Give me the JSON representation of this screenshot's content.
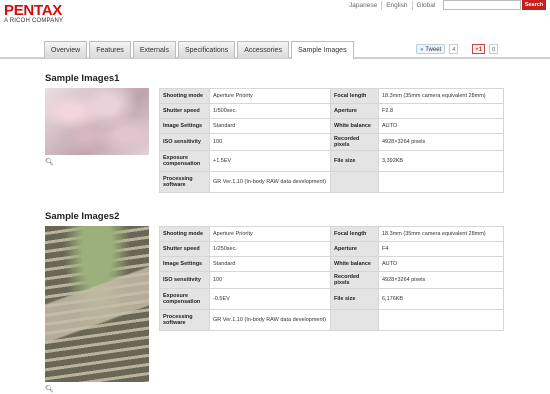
{
  "brand": {
    "name": "PENTAX",
    "tagline": "A RICOH COMPANY",
    "color": "#d20f0f"
  },
  "header": {
    "links": [
      "Japanese",
      "English",
      "Global"
    ],
    "search_placeholder": "",
    "search_button": "Search"
  },
  "tabs": [
    "Overview",
    "Features",
    "Externals",
    "Specifications",
    "Accessories",
    "Sample Images"
  ],
  "active_tab": "Sample Images",
  "social": {
    "tweet_label": "Tweet",
    "tweet_count": "4",
    "gplus_label": "+1",
    "gplus_count": "0"
  },
  "samples": [
    {
      "title": "Sample Images1",
      "rows": [
        {
          "l1": "Shooting mode",
          "v1": "Aperture Priority",
          "l2": "Focal length",
          "v2": "18.3mm (35mm camera equivalent 28mm)"
        },
        {
          "l1": "Shutter speed",
          "v1": "1/500sec.",
          "l2": "Aperture",
          "v2": "F2.8"
        },
        {
          "l1": "Image Settings",
          "v1": "Standard",
          "l2": "White balance",
          "v2": "AUTO"
        },
        {
          "l1": "ISO sensitivity",
          "v1": "100",
          "l2": "Recorded pixels",
          "v2": "4928×3264 pixels"
        },
        {
          "l1": "Exposure compensation",
          "v1": "+1.5EV",
          "l2": "File size",
          "v2": "3,392KB"
        },
        {
          "l1": "Processing software",
          "v1": "GR Ver.1.10 (In-body RAW data development)",
          "l2": "",
          "v2": ""
        }
      ]
    },
    {
      "title": "Sample Images2",
      "rows": [
        {
          "l1": "Shooting mode",
          "v1": "Aperture Priority",
          "l2": "Focal length",
          "v2": "18.3mm (35mm camera equivalent 28mm)"
        },
        {
          "l1": "Shutter speed",
          "v1": "1/250sec.",
          "l2": "Aperture",
          "v2": "F4"
        },
        {
          "l1": "Image Settings",
          "v1": "Standard",
          "l2": "White balance",
          "v2": "AUTO"
        },
        {
          "l1": "ISO sensitivity",
          "v1": "100",
          "l2": "Recorded pixels",
          "v2": "4928×3264 pixels"
        },
        {
          "l1": "Exposure compensation",
          "v1": "-0.5EV",
          "l2": "File size",
          "v2": "6,176KB"
        },
        {
          "l1": "Processing software",
          "v1": "GR Ver.1.10 (In-body RAW data development)",
          "l2": "",
          "v2": ""
        }
      ]
    }
  ]
}
